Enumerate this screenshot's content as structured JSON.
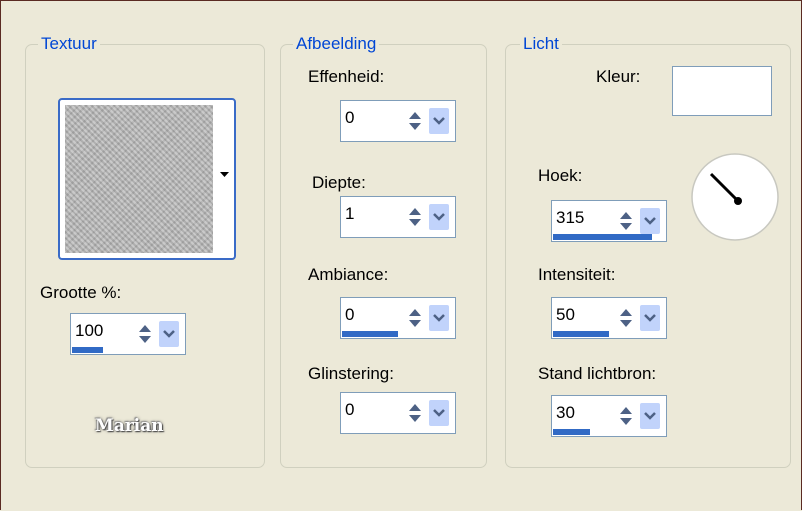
{
  "groups": {
    "texture": {
      "title": "Textuur",
      "size_label": "Grootte %:",
      "size": {
        "value": "100",
        "fill": 0.28
      }
    },
    "image": {
      "title": "Afbeelding",
      "smoothness_label": "Effenheid:",
      "smoothness": {
        "value": "0",
        "fill": 0
      },
      "depth_label": "Diepte:",
      "depth": {
        "value": "1",
        "fill": 0
      },
      "ambiance_label": "Ambiance:",
      "ambiance": {
        "value": "0",
        "fill": 0.5
      },
      "shine_label": "Glinstering:",
      "shine": {
        "value": "0",
        "fill": 0
      }
    },
    "light": {
      "title": "Licht",
      "color_label": "Kleur:",
      "color_value": "#ffffff",
      "angle_label": "Hoek:",
      "angle": {
        "value": "315",
        "fill": 0.88
      },
      "intensity_label": "Intensiteit:",
      "intensity": {
        "value": "50",
        "fill": 0.5
      },
      "elevation_label": "Stand lichtbron:",
      "elevation": {
        "value": "30",
        "fill": 0.33
      }
    }
  },
  "watermark": "Marian",
  "colors": {
    "accent": "#316ac5",
    "legend": "#0046d5",
    "dialog_bg": "#ece9d8"
  },
  "icons": [
    "dropdown-arrow-icon",
    "spin-updown-icon",
    "chevron-down-icon"
  ]
}
